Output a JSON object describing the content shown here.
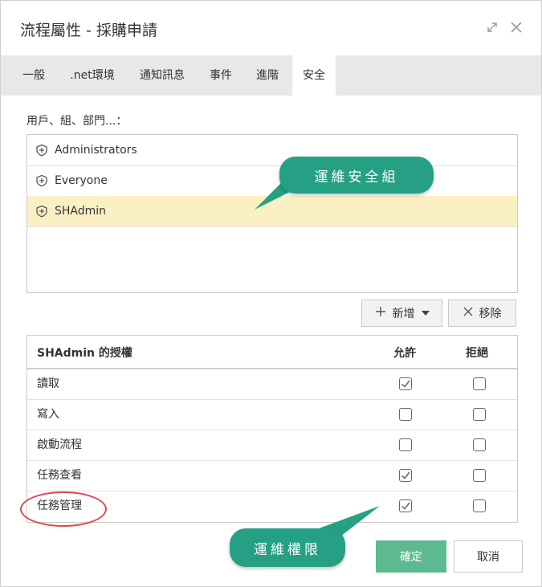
{
  "window": {
    "title": "流程屬性 - 採購申請"
  },
  "tabs": [
    "一般",
    ".net環境",
    "通知訊息",
    "事件",
    "進階",
    "安全"
  ],
  "users_label": "用戶、組、部門...：",
  "users": [
    "Administrators",
    "Everyone",
    "SHAdmin"
  ],
  "buttons": {
    "add": "新增",
    "remove": "移除",
    "ok": "確定",
    "cancel": "取消"
  },
  "permissions": {
    "header": {
      "name": "SHAdmin 的授權",
      "allow": "允許",
      "deny": "拒絕"
    },
    "rows": [
      {
        "name": "讀取",
        "allow": true,
        "deny": false
      },
      {
        "name": "寫入",
        "allow": false,
        "deny": false
      },
      {
        "name": "啟動流程",
        "allow": false,
        "deny": false
      },
      {
        "name": "任務查看",
        "allow": true,
        "deny": false
      },
      {
        "name": "任務管理",
        "allow": true,
        "deny": false
      }
    ]
  },
  "callouts": {
    "security_group": "運維安全組",
    "permission": "運維權限"
  },
  "colors": {
    "accent": "#5cb990",
    "callout": "#26a085",
    "selected_row": "#fbf0c3",
    "highlight_ring": "#e0484c"
  }
}
